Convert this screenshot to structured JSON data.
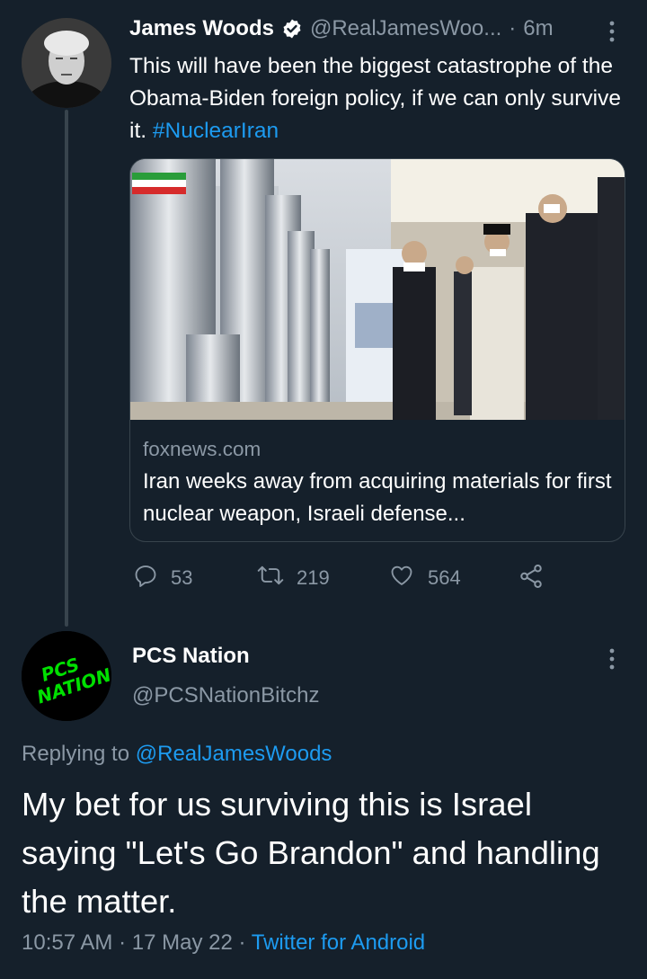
{
  "parent_tweet": {
    "author_name": "James Woods",
    "handle": "@RealJamesWoo...",
    "separator": "·",
    "time": "6m",
    "text": "This will have been the biggest catastrophe of the Obama-Biden foreign policy, if we can only survive it.",
    "hashtag": "#NuclearIran",
    "card": {
      "domain": "foxnews.com",
      "title": "Iran weeks away from acquiring materials for first nuclear weapon, Israeli defense..."
    },
    "actions": {
      "replies": "53",
      "retweets": "219",
      "likes": "564"
    }
  },
  "reply_tweet": {
    "author_name": "PCS Nation",
    "handle": "@PCSNationBitchz",
    "avatar_text": "PCS NATION",
    "replying_prefix": "Replying to",
    "replying_to": "@RealJamesWoods",
    "text": "My bet for us surviving this is Israel saying \"Let's Go Brandon\" and handling the matter.",
    "time": "10:57 AM",
    "sep1": "·",
    "date": "17 May 22",
    "sep2": "·",
    "client": "Twitter for Android"
  },
  "colors": {
    "background": "#15202b",
    "link": "#1d9bf0",
    "muted": "#8b98a5",
    "verified": "#ffffff",
    "avatar_text": "#00e000"
  },
  "icons": [
    "verified-badge-icon",
    "more-vertical-icon",
    "reply-icon",
    "retweet-icon",
    "like-icon",
    "share-icon"
  ]
}
